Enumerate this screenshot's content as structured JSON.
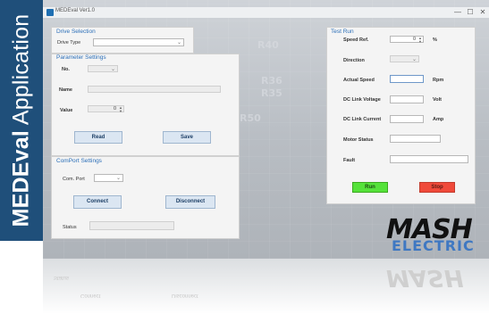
{
  "side_banner": {
    "title_bold": "MEDEval",
    "title_rest": "Application"
  },
  "window": {
    "title": "MEDEval Ver1.0",
    "min": "—",
    "max": "☐",
    "close": "✕"
  },
  "background": {
    "board_labels": [
      "R40",
      "R36",
      "R35",
      "R50"
    ]
  },
  "drive_selection": {
    "title": "Drive Selection",
    "drive_type_label": "Drive Type",
    "drive_type_value": ""
  },
  "parameter_settings": {
    "title": "Parameter Settings",
    "no_label": "No.",
    "name_label": "Name",
    "value_label": "Value",
    "value_value": "0",
    "read_button": "Read",
    "save_button": "Save"
  },
  "comport_settings": {
    "title": "ComPort Settings",
    "com_port_label": "Com. Port",
    "com_port_value": "",
    "connect_button": "Connect",
    "disconnect_button": "Disconnect",
    "status_label": "Status",
    "status_value": ""
  },
  "test_run": {
    "title": "Test Run",
    "speed_ref_label": "Speed Ref.",
    "speed_ref_value": "0",
    "speed_ref_unit": "%",
    "direction_label": "Direction",
    "actual_speed_label": "Actual Speed",
    "actual_speed_unit": "Rpm",
    "dc_link_voltage_label": "DC Link Voltage",
    "dc_link_voltage_unit": "Volt",
    "dc_link_current_label": "DC Link Current",
    "dc_link_current_unit": "Amp",
    "motor_status_label": "Motor Status",
    "fault_label": "Fault",
    "run_button": "Run",
    "stop_button": "Stop",
    "run_color": "#55e23a",
    "stop_color": "#f04a3a"
  },
  "logo": {
    "mash": "MASH",
    "electric": "ELECTRIC"
  },
  "reflection": {
    "status": "Status",
    "connect": "Connect",
    "disconnect": "Disconnect"
  }
}
